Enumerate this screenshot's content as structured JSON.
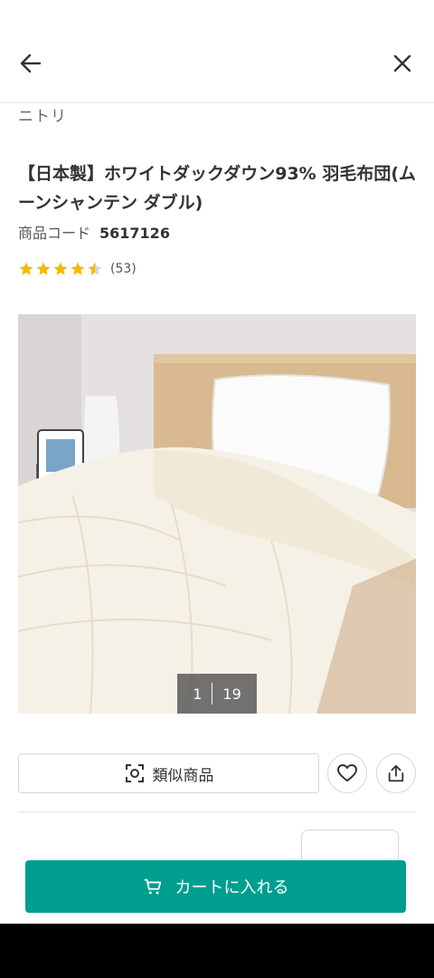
{
  "header": {
    "back_icon": "arrow-left-icon",
    "close_icon": "close-icon"
  },
  "product": {
    "brand": "ニトリ",
    "title": "【日本製】ホワイトダックダウン93% 羽毛布団(ムーンシャンテン ダブル)",
    "code_label": "商品コード",
    "code_value": "5617126",
    "rating": 4.5,
    "review_count": "(53)",
    "image_index": "1",
    "image_total": "19"
  },
  "actions": {
    "similar_label": "類似商品",
    "similar_icon": "camera-scan-icon",
    "favorite_icon": "heart-icon",
    "share_icon": "share-icon",
    "cart_label": "カートに入れる",
    "cart_icon": "cart-icon"
  },
  "colors": {
    "accent": "#009e8f",
    "star": "#f5b800"
  }
}
